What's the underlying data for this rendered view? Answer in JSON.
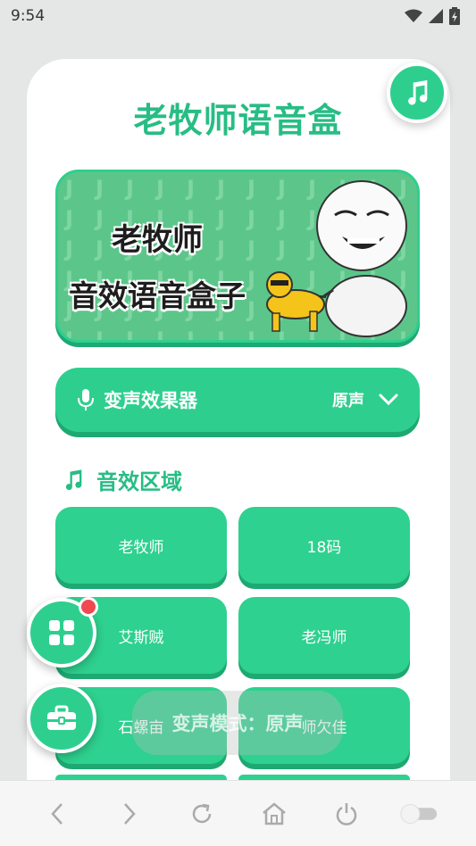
{
  "status_bar": {
    "time": "9:54"
  },
  "app": {
    "title": "老牧师语音盒"
  },
  "banner": {
    "line1": "老牧师",
    "line2": "音效语音盒子"
  },
  "voice_changer": {
    "label": "变声效果器",
    "value": "原声"
  },
  "section": {
    "title": "音效区域"
  },
  "sounds": [
    {
      "label": "老牧师"
    },
    {
      "label": "18码"
    },
    {
      "label": "艾斯贼"
    },
    {
      "label": "老冯师"
    },
    {
      "label": "石螺亩"
    },
    {
      "label": "师欠佳"
    }
  ],
  "toast": {
    "text": "变声模式：原声"
  },
  "colors": {
    "primary": "#2ecf8e",
    "primary_dark": "#1ea872",
    "title": "#27bd84",
    "badge": "#f0494f"
  },
  "icons": {
    "fab_top": "music-note-icon",
    "fab_grid": "grid-icon",
    "fab_toolbox": "toolbox-icon",
    "nav": [
      "back-icon",
      "forward-icon",
      "refresh-icon",
      "home-icon",
      "power-icon",
      "toggle-icon"
    ]
  }
}
